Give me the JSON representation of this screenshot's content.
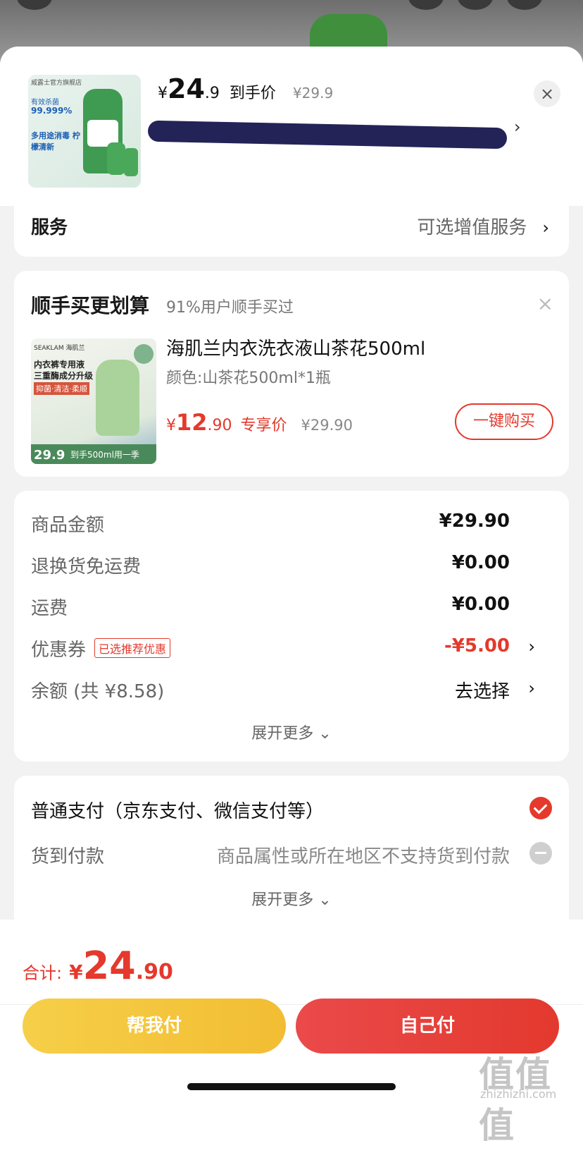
{
  "header": {
    "thumb_text": {
      "shop": "威露士官方旗舰店",
      "claim1": "有效杀菌",
      "claim2": "99.999%",
      "claim3": "多用途消毒 柠檬清新"
    },
    "price_yen": "¥",
    "price_int": "24",
    "price_dec": ".9",
    "price_label": "到手价",
    "original_price": "¥29.9",
    "close_symbol": "×",
    "address_chevron": "›"
  },
  "service": {
    "title": "服务",
    "value": "可选增值服务",
    "chevron": "›"
  },
  "upsell": {
    "title": "顺手买更划算",
    "subtitle": "91%用户顺手买过",
    "close_symbol": "×",
    "image_text": {
      "brand": "SEAKLAM 海肌兰",
      "line1": "内衣裤专用液",
      "line2": "三重酶成分升级",
      "line3": "抑菌·清洁·柔顺",
      "bar_price": "29.9",
      "bar_text": "到手500ml用一季"
    },
    "product_name": "海肌兰内衣洗衣液山茶花500ml",
    "spec": "颜色:山茶花500ml*1瓶",
    "price_yen": "¥",
    "price_int": "12",
    "price_dec": ".90",
    "price_label": "专享价",
    "original_price": "¥29.90",
    "buy_button": "一键购买"
  },
  "fees": {
    "rows": [
      {
        "label": "商品金额",
        "value": "¥29.90"
      },
      {
        "label": "退换货免运费",
        "value": "¥0.00"
      },
      {
        "label": "运费",
        "value": "¥0.00"
      },
      {
        "label": "优惠券",
        "tag": "已选推荐优惠",
        "value": "-¥5.00",
        "chevron": "›"
      },
      {
        "label": "余额 (共 ¥8.58)",
        "value": "去选择",
        "chevron": "›"
      }
    ],
    "expand": "展开更多 ⌄"
  },
  "payment": {
    "options": [
      {
        "label": "普通支付（京东支付、微信支付等）",
        "note": ""
      },
      {
        "label": "货到付款",
        "note": "商品属性或所在地区不支持货到付款"
      }
    ],
    "expand": "展开更多 ⌄"
  },
  "footer": {
    "total_label": "合计:",
    "total_yen": "¥",
    "total_int": "24",
    "total_dec": ".90",
    "help_pay": "帮我付",
    "self_pay": "自己付"
  },
  "watermark": {
    "logo": "值值值",
    "url": "zhizhizhi.com"
  },
  "colors": {
    "accent_red": "#e4392c",
    "help_yellow": "#f6cf48"
  }
}
